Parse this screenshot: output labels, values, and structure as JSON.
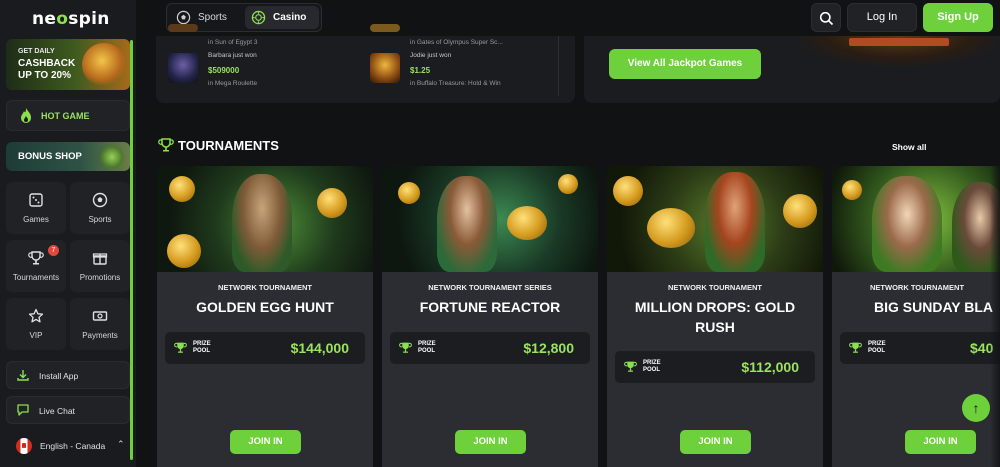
{
  "brand": {
    "logo_text_a": "ne",
    "logo_text_o": "o",
    "logo_text_b": "spin"
  },
  "sidebar": {
    "cashback": {
      "line1": "GET DAILY",
      "line2": "CASHBACK",
      "line3": "UP TO 20%"
    },
    "hot_game": "HOT GAME",
    "bonus_shop": "BONUS SHOP",
    "tiles": [
      {
        "label": "Games",
        "icon": "dice-icon"
      },
      {
        "label": "Sports",
        "icon": "soccer-ball-icon"
      },
      {
        "label": "Tournaments",
        "icon": "trophy-icon",
        "badge": "7"
      },
      {
        "label": "Promotions",
        "icon": "gift-icon"
      },
      {
        "label": "VIP",
        "icon": "star-icon"
      },
      {
        "label": "Payments",
        "icon": "cash-icon"
      }
    ],
    "install_app": "Install App",
    "live_chat": "Live Chat",
    "language": "English - Canada"
  },
  "header": {
    "tabs": [
      {
        "label": "Sports"
      },
      {
        "label": "Casino"
      }
    ],
    "login": "Log In",
    "signup": "Sign Up"
  },
  "winners": [
    {
      "top_line": "in Sun of Egypt 3",
      "player": "Barbara just won",
      "amount": "$509000",
      "game": "in Mega Roulette"
    },
    {
      "top_line": "in Gates of Olympus Super Sc...",
      "player": "Jodie just won",
      "amount": "$1.25",
      "game": "in Buffalo Treasure: Hold & Win"
    }
  ],
  "jackpot": {
    "button": "View All Jackpot Games"
  },
  "tournaments": {
    "title": "TOURNAMENTS",
    "show_all": "Show all",
    "prize_label": "PRIZE POOL",
    "join_label": "JOIN IN",
    "cards": [
      {
        "kind": "NETWORK TOURNAMENT",
        "name": "GOLDEN EGG HUNT",
        "prize": "$144,000"
      },
      {
        "kind": "NETWORK TOURNAMENT SERIES",
        "name": "FORTUNE REACTOR",
        "prize": "$12,800"
      },
      {
        "kind": "NETWORK TOURNAMENT",
        "name": "MILLION DROPS: GOLD RUSH",
        "prize": "$112,000"
      },
      {
        "kind": "NETWORK TOURNAMENT",
        "name": "BIG SUNDAY BLA",
        "prize": "$40"
      }
    ]
  },
  "colors": {
    "accent": "#6ed13c",
    "accent_text": "#9be35e",
    "bg": "#111214",
    "panel": "#1b1c20",
    "card": "#2b2d33"
  }
}
